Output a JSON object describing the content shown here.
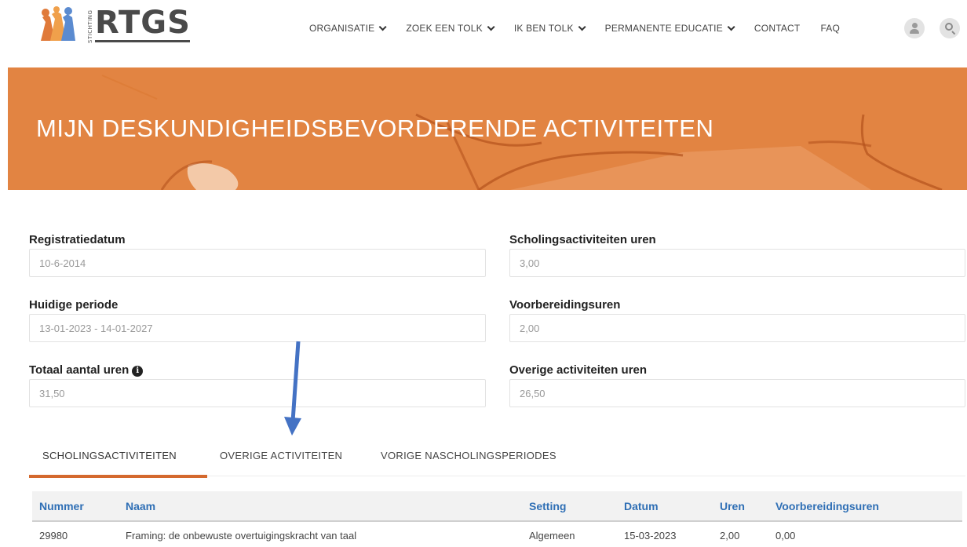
{
  "brand": {
    "name": "RTGS",
    "tagline_vertical": "STICHTING"
  },
  "nav": {
    "items": [
      {
        "label": "ORGANISATIE",
        "dropdown": true
      },
      {
        "label": "ZOEK EEN TOLK",
        "dropdown": true
      },
      {
        "label": "IK BEN TOLK",
        "dropdown": true
      },
      {
        "label": "PERMANENTE EDUCATIE",
        "dropdown": true
      },
      {
        "label": "CONTACT",
        "dropdown": false
      },
      {
        "label": "FAQ",
        "dropdown": false
      }
    ],
    "user_icon": "user-icon",
    "search_icon": "search-icon"
  },
  "banner": {
    "title": "MIJN DESKUNDIGHEIDSBEVORDERENDE ACTIVITEITEN",
    "color": "#e28442"
  },
  "fields": {
    "registratiedatum": {
      "label": "Registratiedatum",
      "value": "10-6-2014"
    },
    "huidige_periode": {
      "label": "Huidige periode",
      "value": "13-01-2023 - 14-01-2027"
    },
    "totaal_uren": {
      "label": "Totaal aantal uren",
      "value": "31,50",
      "info_icon": "info-icon"
    },
    "scholing_uren": {
      "label": "Scholingsactiviteiten uren",
      "value": "3,00"
    },
    "voorbereidingsuren": {
      "label": "Voorbereidingsuren",
      "value": "2,00"
    },
    "overige_uren": {
      "label": "Overige activiteiten uren",
      "value": "26,50"
    }
  },
  "tabs": [
    {
      "label": "SCHOLINGSACTIVITEITEN",
      "active": true
    },
    {
      "label": "OVERIGE ACTIVITEITEN",
      "active": false
    },
    {
      "label": "VORIGE NASCHOLINGSPERIODES",
      "active": false
    }
  ],
  "table": {
    "headers": [
      "Nummer",
      "Naam",
      "Setting",
      "Datum",
      "Uren",
      "Voorbereidingsuren"
    ],
    "rows": [
      [
        "29980",
        "Framing: de onbewuste overtuigingskracht van taal",
        "Algemeen",
        "15-03-2023",
        "2,00",
        "0,00"
      ]
    ]
  },
  "colors": {
    "accent": "#d4692e",
    "header_text": "#2f6fb5",
    "arrow": "#4472c4"
  }
}
